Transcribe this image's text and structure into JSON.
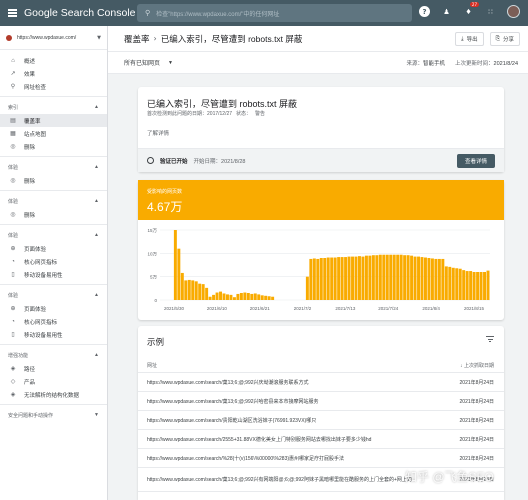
{
  "topbar": {
    "brand": "Google Search Console",
    "search_placeholder": "检查\"https://www.wpdaxue.com/\"中的任何网址",
    "notification_count": "27",
    "icons": [
      "menu-icon",
      "search-icon",
      "help-icon",
      "people-icon",
      "bell-icon",
      "apps-icon",
      "avatar"
    ]
  },
  "sidebar": {
    "property": "https://www.wpdaxue.com/",
    "items_top": [
      {
        "label": "概述",
        "icon": "home-icon"
      },
      {
        "label": "效果",
        "icon": "trending-icon"
      },
      {
        "label": "网址检查",
        "icon": "search-icon"
      }
    ],
    "section_index": "索引",
    "items_index": [
      {
        "label": "覆盖率",
        "icon": "file-icon",
        "active": true
      },
      {
        "label": "站点地图",
        "icon": "sitemap-icon"
      },
      {
        "label": "删除",
        "icon": "eye-off-icon"
      }
    ],
    "section_2": "体验",
    "items_2": [
      {
        "label": "删除",
        "icon": "eye-off-icon"
      }
    ],
    "section_3": "体验",
    "items_3": [
      {
        "label": "删除",
        "icon": "eye-off-icon"
      }
    ],
    "section_4": "体验",
    "items_4": [
      {
        "label": "页面体验",
        "icon": "add-circle-icon"
      },
      {
        "label": "核心网页指标",
        "icon": "gauge-icon"
      },
      {
        "label": "移动设备易用性",
        "icon": "phone-icon"
      }
    ],
    "section_5": "体验",
    "items_5": [
      {
        "label": "页面体验",
        "icon": "add-circle-icon"
      },
      {
        "label": "核心网页指标",
        "icon": "gauge-icon"
      },
      {
        "label": "移动设备易用性",
        "icon": "phone-icon"
      }
    ],
    "section_6": "增强功能",
    "items_6": [
      {
        "label": "路径",
        "icon": "layers-icon"
      },
      {
        "label": "产品",
        "icon": "diamond-icon"
      },
      {
        "label": "无法解析的结构化数据",
        "icon": "layers-icon"
      }
    ],
    "section_7": "安全问题和手动操作"
  },
  "header": {
    "crumb_1": "覆盖率",
    "crumb_sep": "›",
    "crumb_2": "已编入索引，尽管遭到 robots.txt 屏蔽",
    "export_label": "导出",
    "share_label": "分享"
  },
  "filterbar": {
    "select_label": "所有已知网页",
    "source_label": "来源：",
    "source_value": "智能手机",
    "updated_label": "上次更新时间：",
    "updated_value": "2021/8/24"
  },
  "issue": {
    "title": "已编入索引，尽管遭到 robots.txt 屏蔽",
    "first_detected": "首次检测到此问题的日期：2017/12/27",
    "status": "状态：",
    "status_value": "警告",
    "learn_more": "了解详情",
    "validation_label": "验证已开始",
    "validation_date": "开始日期：2021/8/28",
    "details_button": "查看详情"
  },
  "chart_card": {
    "label": "受影响的网页数",
    "total": "4.67万",
    "header_color": "#f9ab00",
    "bar_color": "#f9ab00"
  },
  "chart_data": {
    "type": "bar",
    "yticks": [
      "15万",
      "10万",
      "5万",
      "0"
    ],
    "ylim": [
      0,
      150000
    ],
    "xticks": [
      "2021/5/30",
      "2021/6/10",
      "2021/6/21",
      "2021/7/2",
      "2021/7/13",
      "2021/7/24",
      "2021/8/4",
      "2021/8/15"
    ],
    "values": [
      0,
      0,
      0,
      0,
      150000,
      110000,
      58000,
      42000,
      43000,
      42000,
      40000,
      35000,
      34000,
      26000,
      7000,
      11000,
      16000,
      18000,
      14000,
      12000,
      11000,
      6000,
      13000,
      15000,
      16000,
      15000,
      13000,
      14000,
      12000,
      10000,
      9000,
      8000,
      7000,
      0,
      0,
      0,
      0,
      0,
      0,
      0,
      0,
      0,
      50000,
      88000,
      89000,
      88000,
      90000,
      90000,
      91000,
      91000,
      91000,
      92000,
      92000,
      92000,
      93000,
      93000,
      93000,
      94000,
      93000,
      95000,
      95000,
      96000,
      96000,
      97000,
      97000,
      97000,
      97000,
      97000,
      97000,
      97000,
      96000,
      96000,
      95000,
      93000,
      93000,
      92000,
      91000,
      90000,
      89000,
      88000,
      88000,
      88000,
      72000,
      71000,
      69000,
      68000,
      67000,
      64000,
      62000,
      62000,
      60000,
      60000,
      60000,
      60000,
      63000
    ]
  },
  "examples": {
    "title": "示例",
    "col_url": "网址",
    "col_date": "上次抓取日期",
    "rows": [
      {
        "url": "https://www.wpdaxue.com/search/菓13;6;@;992兴庆坳潮滚服务联系方式",
        "date": "2021年8月24日"
      },
      {
        "url": "https://www.wpdaxue.com/search/菓13;6;@;992兴哈密县来本市接摩网站服务",
        "date": "2021年8月24日"
      },
      {
        "url": "https://www.wpdaxue.com/search/贵阳乾山湖区洗浴妹子(76991.923VX)哪只",
        "date": "2021年8月24日"
      },
      {
        "url": "https://www.wpdaxue.com/search/2555+31.88VX德化美女上门特别服务网站去哪找出妹子要多少钱hd",
        "date": "2021年8月24日"
      },
      {
        "url": "https://www.wpdaxue.com/search/%28(十(v)156\\%00000\\%283)惠州哪家足疗打屁股手法",
        "date": "2021年8月24日"
      },
      {
        "url": "https://www.wpdaxue.com/search/菓13;6;@;992兴有网端阳@;6;@;992阿妹子黑暗哪里能在酷服务的上门全套的+网上的",
        "date": "2021年8月24日"
      }
    ]
  },
  "watermark": "知乎 @飞鱼SEO"
}
